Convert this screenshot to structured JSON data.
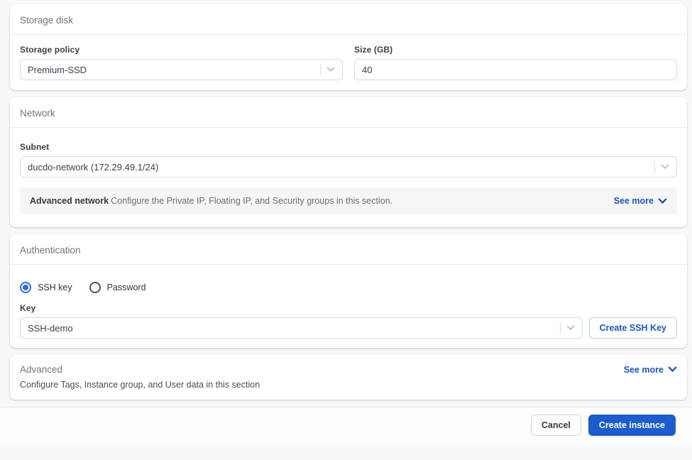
{
  "sections": {
    "storage": {
      "title": "Storage disk",
      "storage_policy": {
        "label": "Storage policy",
        "value": "Premium-SSD"
      },
      "size": {
        "label": "Size (GB)",
        "value": "40"
      }
    },
    "network": {
      "title": "Network",
      "subnet": {
        "label": "Subnet",
        "value": "ducdo-network (172.29.49.1/24)"
      },
      "advanced_bar": {
        "title": "Advanced network",
        "description": "Configure the Private IP, Floating IP, and Security groups in this section.",
        "see_more_label": "See more"
      }
    },
    "authentication": {
      "title": "Authentication",
      "methods": [
        {
          "label": "SSH key",
          "selected": true
        },
        {
          "label": "Password",
          "selected": false
        }
      ],
      "key": {
        "label": "Key",
        "value": "SSH-demo"
      },
      "create_key_button": "Create SSH Key"
    },
    "advanced": {
      "title": "Advanced",
      "description": "Configure Tags, Instance group, and User data in this section",
      "see_more_label": "See more"
    }
  },
  "footer": {
    "cancel_label": "Cancel",
    "submit_label": "Create instance"
  },
  "colors": {
    "accent": "#1d5bd1",
    "link_blue": "#1956c8",
    "radio_selected": "#2e6be5"
  }
}
